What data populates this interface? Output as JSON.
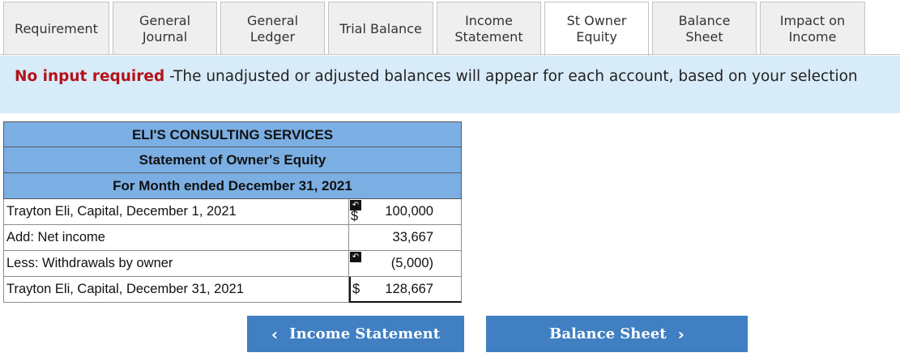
{
  "tabs": [
    {
      "label": "Requirement",
      "active": false
    },
    {
      "label": "General Journal",
      "active": false
    },
    {
      "label": "General Ledger",
      "active": false
    },
    {
      "label": "Trial Balance",
      "active": false
    },
    {
      "label": "Income Statement",
      "active": false
    },
    {
      "label": "St Owner Equity",
      "active": true
    },
    {
      "label": "Balance Sheet",
      "active": false
    },
    {
      "label": "Impact on Income",
      "active": false
    }
  ],
  "banner": {
    "strong": "No input required",
    "text": " -The unadjusted or adjusted balances will appear for each account, based on your selection"
  },
  "statement": {
    "company": "ELI'S CONSULTING SERVICES",
    "title": "Statement of Owner's Equity",
    "period": "For Month ended December 31, 2021",
    "rows": [
      {
        "label": "Trayton Eli, Capital, December 1, 2021",
        "currency": "$",
        "amount": "100,000",
        "undo": true
      },
      {
        "label": "Add: Net income",
        "currency": "",
        "amount": "33,667",
        "undo": false
      },
      {
        "label": "Less: Withdrawals by owner",
        "currency": "",
        "amount": "(5,000)",
        "undo": true
      },
      {
        "label": "Trayton Eli, Capital, December 31, 2021",
        "currency": "$",
        "amount": "128,667",
        "undo": false
      }
    ]
  },
  "nav": {
    "prev_label": "Income Statement",
    "next_label": "Balance Sheet",
    "prev_icon": "chevron-left-icon",
    "next_icon": "chevron-right-icon"
  },
  "colors": {
    "header_fill": "#7bafe3",
    "banner_fill": "#d8ebf8",
    "button_fill": "#3f7fc2",
    "alert_text": "#b3121a"
  }
}
